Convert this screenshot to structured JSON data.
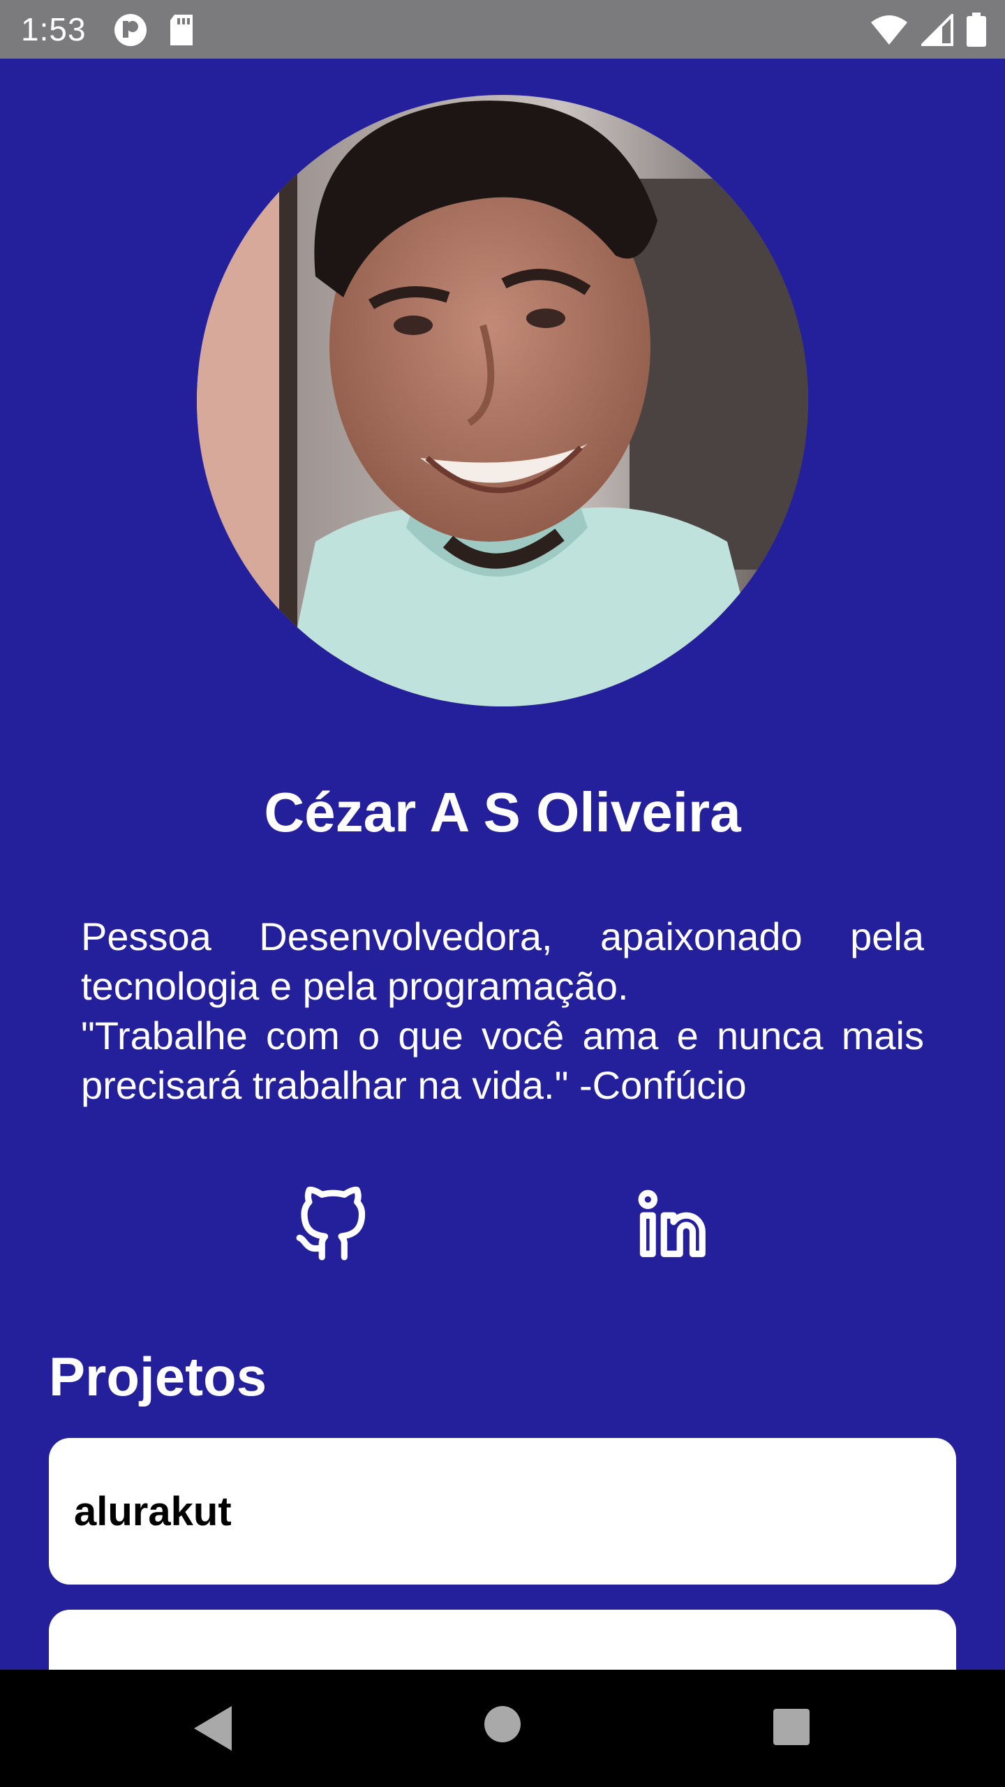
{
  "status_bar": {
    "time": "1:53",
    "left_icons": [
      "notification-icon",
      "sd-card-icon"
    ],
    "right_icons": [
      "wifi-icon",
      "cell-signal-icon",
      "battery-icon"
    ]
  },
  "profile": {
    "photo_icon": "profile-photo",
    "name": "Cézar A S Oliveira",
    "bio_line_1": "Pessoa Desenvolvedora, apaixonado pela tecnologia e pela programação.",
    "bio_line_2": "\"Trabalhe com o que você ama e nunca mais precisará trabalhar na vida.\" -Confúcio"
  },
  "social": {
    "github_icon": "github-icon",
    "linkedin_icon": "linkedin-icon"
  },
  "projects": {
    "title": "Projetos",
    "items": [
      {
        "label": "alurakut"
      },
      {
        "label": ""
      }
    ]
  },
  "nav": {
    "back_icon": "back-icon",
    "home_icon": "home-icon",
    "recents_icon": "recents-icon"
  },
  "colors": {
    "background": "#241f9a",
    "status_bar": "#7b7b7d",
    "card": "#ffffff",
    "text_light": "#ffffff"
  }
}
